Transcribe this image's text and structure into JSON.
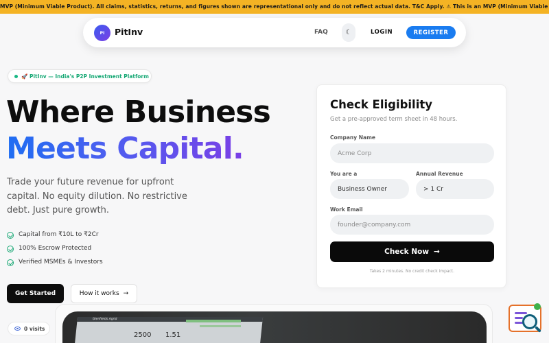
{
  "ticker": {
    "text": "MVP (Minimum Viable Product). All claims, statistics, returns, and figures shown are representational only and do not reflect actual data. T&C Apply.        ⚠ This is an MVP (Minimum Viable Product). All claims, statistics, returns, and figures shown are representational only and do not reflect actual data. T&C Apply."
  },
  "nav": {
    "logo_badge": "PI",
    "brand": "PitInv",
    "faq": "FAQ",
    "theme_icon": "moon-icon",
    "login": "LOGIN",
    "register": "REGISTER"
  },
  "hero": {
    "pill": "🚀 PitInv — India's P2P Investment Platform",
    "line1": "Where Business",
    "line2": "Meets Capital.",
    "subtext": "Trade your future revenue for upfront capital. No equity dilution. No restrictive debt. Just pure growth.",
    "features": [
      "Capital from ₹10L to ₹2Cr",
      "100% Escrow Protected",
      "Verified MSMEs & Investors"
    ],
    "get_started": "Get Started",
    "how_it_works": "How it works",
    "how_arrow": "→",
    "visits": "0 visits"
  },
  "dashboard": {
    "label": "Glenfields Agrid",
    "num1": "2500",
    "num2": "1.51"
  },
  "form": {
    "title": "Check Eligibility",
    "subtitle": "Get a pre-approved term sheet in 48 hours.",
    "company_label": "Company Name",
    "company_placeholder": "Acme Corp",
    "role_label": "You are a",
    "role_value": "Business Owner",
    "revenue_label": "Annual Revenue",
    "revenue_value": "> 1 Cr",
    "email_label": "Work Email",
    "email_placeholder": "founder@company.com",
    "submit": "Check Now",
    "submit_arrow": "→",
    "footnote": "Takes 2 minutes. No credit check impact."
  },
  "colors": {
    "ticker_bg": "#f4b324",
    "accent_blue": "#1a7cf0",
    "gradient_start": "#1f6ef2",
    "gradient_end": "#7a3fe6",
    "success_green": "#18a874"
  }
}
